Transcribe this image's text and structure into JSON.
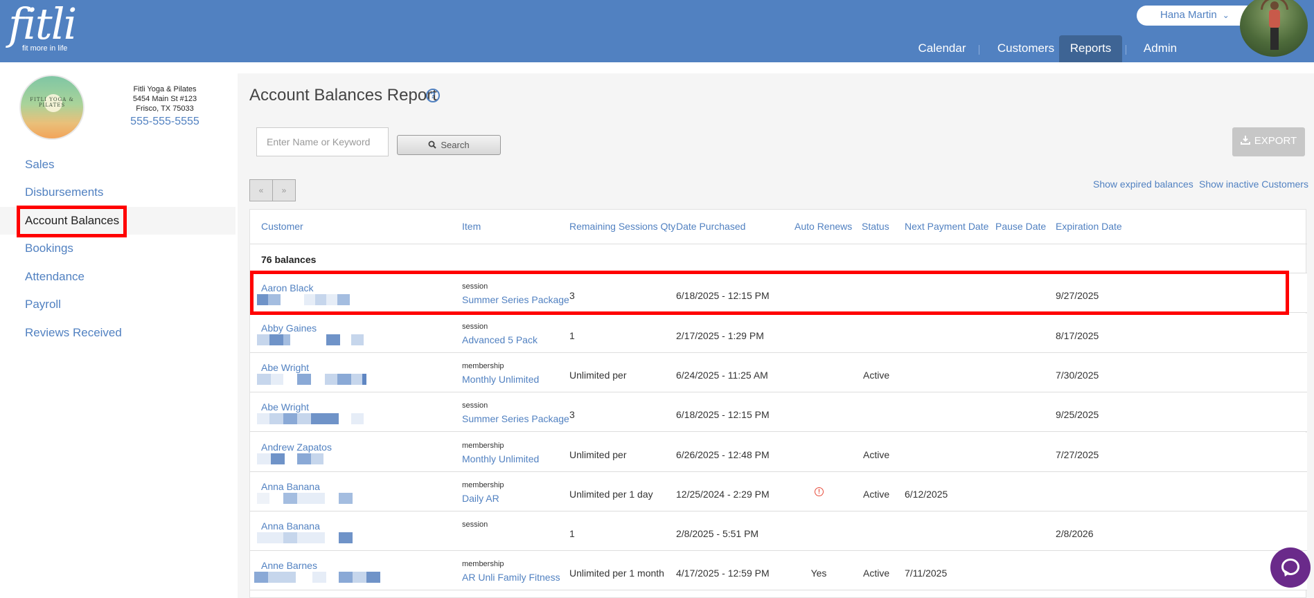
{
  "app": {
    "logo_text": "fitli",
    "logo_tagline": "fit more in life",
    "user_name": "Hana Martin",
    "user_menu_chevron": "chevron-down-icon"
  },
  "nav": {
    "items": [
      {
        "label": "Calendar",
        "active": false
      },
      {
        "label": "Customers",
        "active": false
      },
      {
        "label": "Reports",
        "active": true
      },
      {
        "label": "Admin",
        "active": false
      }
    ]
  },
  "studio": {
    "logo_text": "FITLI YOGA & PILATES",
    "name": "Fitli Yoga & Pilates",
    "address_line1": "5454 Main St #123",
    "address_line2": "Frisco, TX 75033",
    "phone": "555-555-5555"
  },
  "sidebar": {
    "items": [
      {
        "label": "Sales",
        "active": false
      },
      {
        "label": "Disbursements",
        "active": false
      },
      {
        "label": "Account Balances",
        "active": true
      },
      {
        "label": "Bookings",
        "active": false
      },
      {
        "label": "Attendance",
        "active": false
      },
      {
        "label": "Payroll",
        "active": false
      },
      {
        "label": "Reviews Received",
        "active": false
      }
    ]
  },
  "page": {
    "title": "Account Balances Report",
    "help_icon": "?"
  },
  "search": {
    "placeholder": "Enter Name or Keyword",
    "value": "",
    "button_label": "Search"
  },
  "export": {
    "label": "EXPORT"
  },
  "pager": {
    "prev": "«",
    "next": "»"
  },
  "links": {
    "show_expired": "Show expired balances",
    "show_inactive": "Show inactive Customers"
  },
  "table": {
    "headers": {
      "customer": "Customer",
      "item": "Item",
      "remaining": "Remaining Sessions Qty",
      "date_purchased": "Date Purchased",
      "auto_renews": "Auto Renews",
      "status": "Status",
      "next_payment": "Next Payment Date",
      "pause": "Pause Date",
      "expiration": "Expiration Date"
    },
    "count_label": "76 balances",
    "rows": [
      {
        "customer": "Aaron Black",
        "item_type": "session",
        "item_name": "Summer Series Package",
        "remaining": "3",
        "date_purchased": "6/18/2025 - 12:15 PM",
        "auto_renews": "",
        "status": "",
        "next_payment": "",
        "pause": "",
        "expiration": "9/27/2025"
      },
      {
        "customer": "Abby Gaines",
        "item_type": "session",
        "item_name": "Advanced 5 Pack",
        "remaining": "1",
        "date_purchased": "2/17/2025 - 1:29 PM",
        "auto_renews": "",
        "status": "",
        "next_payment": "",
        "pause": "",
        "expiration": "8/17/2025"
      },
      {
        "customer": "Abe Wright",
        "item_type": "membership",
        "item_name": "Monthly Unlimited",
        "remaining": "Unlimited per",
        "date_purchased": "6/24/2025 - 11:25 AM",
        "auto_renews": "",
        "status": "Active",
        "next_payment": "",
        "pause": "",
        "expiration": "7/30/2025"
      },
      {
        "customer": "Abe Wright",
        "item_type": "session",
        "item_name": "Summer Series Package",
        "remaining": "3",
        "date_purchased": "6/18/2025 - 12:15 PM",
        "auto_renews": "",
        "status": "",
        "next_payment": "",
        "pause": "",
        "expiration": "9/25/2025"
      },
      {
        "customer": "Andrew Zapatos",
        "item_type": "membership",
        "item_name": "Monthly Unlimited",
        "remaining": "Unlimited per",
        "date_purchased": "6/26/2025 - 12:48 PM",
        "auto_renews": "",
        "status": "Active",
        "next_payment": "",
        "pause": "",
        "expiration": "7/27/2025"
      },
      {
        "customer": "Anna Banana",
        "item_type": "membership",
        "item_name": "Daily AR",
        "remaining": "Unlimited per 1 day",
        "date_purchased": "12/25/2024 - 2:29 PM",
        "auto_renews": "",
        "auto_renews_alert": "!",
        "status": "Active",
        "next_payment": "6/12/2025",
        "pause": "",
        "expiration": ""
      },
      {
        "customer": "Anna Banana",
        "item_type": "session",
        "item_name": "",
        "remaining": "1",
        "date_purchased": "2/8/2025 - 5:51 PM",
        "auto_renews": "",
        "status": "",
        "next_payment": "",
        "pause": "",
        "expiration": "2/8/2026"
      },
      {
        "customer": "Anne Barnes",
        "item_type": "membership",
        "item_name": "AR Unli Family Fitness",
        "remaining": "Unlimited per 1 month",
        "date_purchased": "4/17/2025 - 12:59 PM",
        "auto_renews": "Yes",
        "status": "Active",
        "next_payment": "7/11/2025",
        "pause": "",
        "expiration": ""
      }
    ]
  },
  "colors": {
    "brand": "#5181c1",
    "brand_dark": "#3e6494",
    "highlight": "#ff0000",
    "chat": "#6a2a8a",
    "alert": "#e74c3c"
  },
  "icons": {
    "help": "help-icon",
    "search": "search-icon",
    "export": "download-icon",
    "chat": "chat-icon",
    "alert": "alert-icon"
  }
}
